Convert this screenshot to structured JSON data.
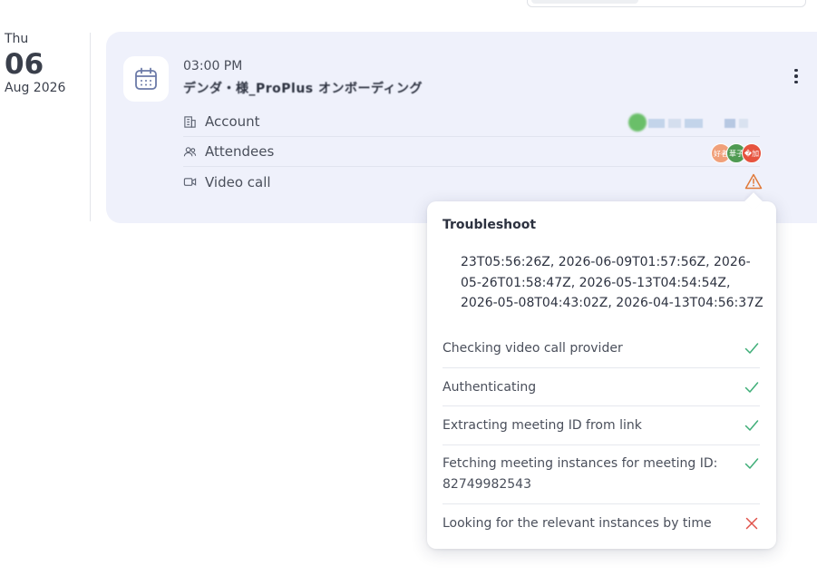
{
  "date": {
    "dow": "Thu",
    "day": "06",
    "month_year": "Aug 2026"
  },
  "event": {
    "time": "03:00 PM",
    "title": "デンダ・様_ProPlus オンボーディング",
    "rows": [
      {
        "label": "Account",
        "icon": "building-icon"
      },
      {
        "label": "Attendees",
        "icon": "users-icon"
      },
      {
        "label": "Video call",
        "icon": "video-camera-icon"
      }
    ],
    "attendees": [
      {
        "initials": "好者",
        "color": "#f0a07a"
      },
      {
        "initials": "華子",
        "color": "#4f9a52"
      },
      {
        "initials": "�加",
        "color": "#e6533f"
      }
    ],
    "warning_color": "#e07a3a"
  },
  "troubleshoot": {
    "title": "Troubleshoot",
    "timestamps": "23T05:56:26Z, 2026-06-09T01:57:56Z, 2026-05-26T01:58:47Z, 2026-05-13T04:54:54Z, 2026-05-08T04:43:02Z, 2026-04-13T04:56:37Z",
    "steps": [
      {
        "label": "Checking video call provider",
        "status": "success"
      },
      {
        "label": "Authenticating",
        "status": "success"
      },
      {
        "label": "Extracting meeting ID from link",
        "status": "success"
      },
      {
        "label": "Fetching meeting instances for meeting ID: 82749982543",
        "status": "success"
      },
      {
        "label": "Looking for the relevant instances by time",
        "status": "failure"
      }
    ],
    "colors": {
      "success": "#3fae78",
      "failure": "#e0524a"
    }
  }
}
